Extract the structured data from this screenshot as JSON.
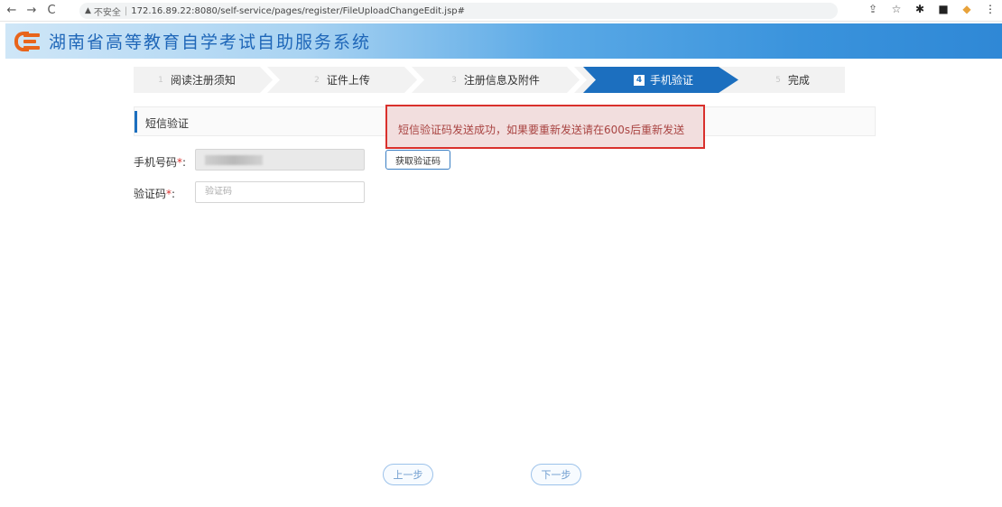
{
  "browser": {
    "insecure_label": "不安全",
    "url": "172.16.89.22:8080/self-service/pages/register/FileUploadChangeEdit.jsp#"
  },
  "app": {
    "title": "湖南省高等教育自学考试自助服务系统"
  },
  "steps": [
    {
      "num": "1",
      "label": "阅读注册须知",
      "active": false
    },
    {
      "num": "2",
      "label": "证件上传",
      "active": false
    },
    {
      "num": "3",
      "label": "注册信息及附件",
      "active": false
    },
    {
      "num": "4",
      "label": "手机验证",
      "active": true
    },
    {
      "num": "5",
      "label": "完成",
      "active": false
    }
  ],
  "section": {
    "title": "短信验证"
  },
  "alert": {
    "message": "短信验证码发送成功，如果要重新发送请在600s后重新发送"
  },
  "form": {
    "phone_label": "手机号码",
    "required_mark": "*",
    "colon": ":",
    "code_label": "验证码",
    "code_placeholder": "验证码",
    "get_code_button": "获取验证码"
  },
  "buttons": {
    "prev": "上一步",
    "next": "下一步"
  },
  "colors": {
    "accent": "#1c6fbf",
    "alert_border": "#d9302c",
    "alert_bg": "#f2dede",
    "logo": "#e8641b"
  }
}
